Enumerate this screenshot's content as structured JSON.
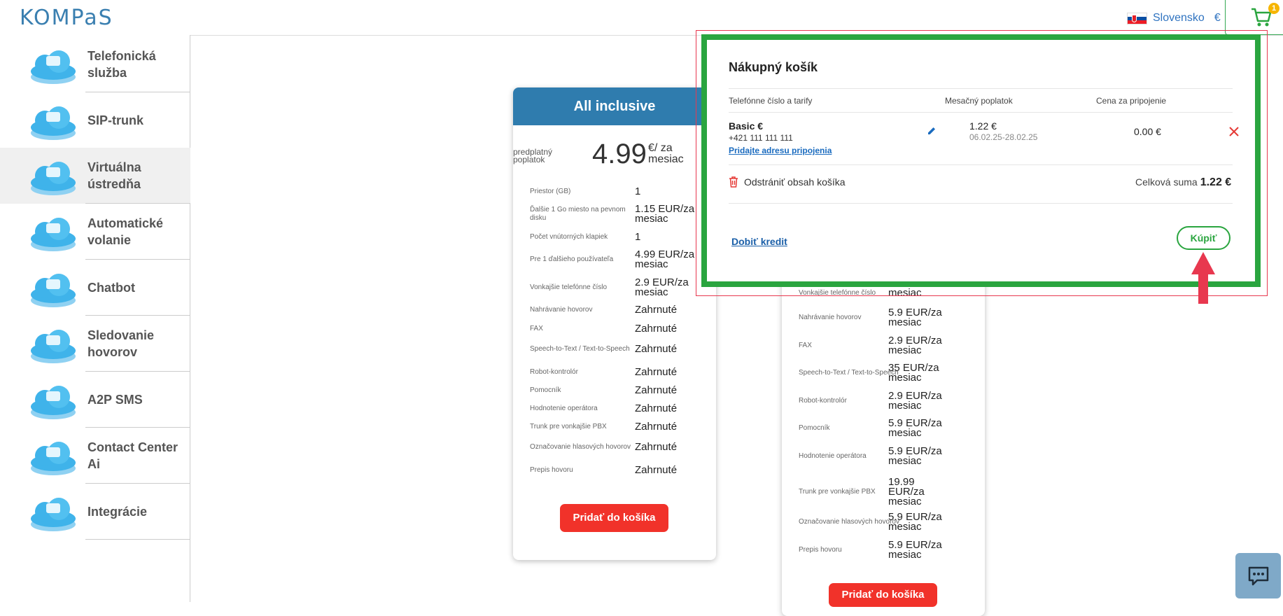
{
  "header": {
    "logo": "KOMPaS",
    "language": "Slovensko",
    "currency": "€",
    "cart_count": "1"
  },
  "sidebar": {
    "items": [
      {
        "label": "Telefonická služba",
        "icon": "phone-service-cloud-icon"
      },
      {
        "label": "SIP-trunk",
        "icon": "sip-trunk-cloud-icon"
      },
      {
        "label": "Virtuálna ústredňa",
        "icon": "virtual-pbx-cloud-icon"
      },
      {
        "label": "Automatické volanie",
        "icon": "auto-dialer-cloud-icon"
      },
      {
        "label": "Chatbot",
        "icon": "chatbot-cloud-icon"
      },
      {
        "label": "Sledovanie hovorov",
        "icon": "call-tracking-cloud-icon"
      },
      {
        "label": "A2P SMS",
        "icon": "sms-cloud-icon"
      },
      {
        "label": "Contact Center Ai",
        "icon": "contact-center-cloud-icon"
      },
      {
        "label": "Integrácie",
        "icon": "integrations-cloud-icon"
      }
    ]
  },
  "plan1": {
    "title": "All inclusive",
    "fee_label": "predplatný poplatok",
    "price": "4.99",
    "price_unit": "€/ za mesiac",
    "rows": [
      {
        "k": "Priestor (GB)",
        "v": "1"
      },
      {
        "k": "Ďalšie 1 Go miesto na pevnom disku",
        "v": "1.15 EUR/za mesiac"
      },
      {
        "k": "Počet vnútorných klapiek",
        "v": "1"
      },
      {
        "k": "Pre 1 ďalšieho používateľa",
        "v": "4.99 EUR/za mesiac"
      },
      {
        "k": "Vonkajšie telefónne číslo",
        "v": "2.9 EUR/za mesiac"
      },
      {
        "k": "Nahrávanie hovorov",
        "v": "Zahrnuté"
      },
      {
        "k": "FAX",
        "v": "Zahrnuté"
      },
      {
        "k": "Speech-to-Text / Text-to-Speech",
        "v": "Zahrnuté"
      },
      {
        "k": "Robot-kontrolór",
        "v": "Zahrnuté"
      },
      {
        "k": "Pomocník",
        "v": "Zahrnuté"
      },
      {
        "k": "Hodnotenie operátora",
        "v": "Zahrnuté"
      },
      {
        "k": "Trunk pre vonkajšie PBX",
        "v": "Zahrnuté"
      },
      {
        "k": "Označovanie hlasových hovorov",
        "v": "Zahrnuté"
      },
      {
        "k": "Prepis hovoru",
        "v": "Zahrnuté"
      }
    ],
    "button": "Pridať do košíka"
  },
  "plan2": {
    "partial_row": {
      "k": "Vonkajšie telefónne číslo",
      "v": "mesiac"
    },
    "rows": [
      {
        "k": "Nahrávanie hovorov",
        "v": "5.9 EUR/za mesiac"
      },
      {
        "k": "FAX",
        "v": "2.9 EUR/za mesiac"
      },
      {
        "k": "Speech-to-Text / Text-to-Speech",
        "v": "35 EUR/za mesiac"
      },
      {
        "k": "Robot-kontrolór",
        "v": "2.9 EUR/za mesiac"
      },
      {
        "k": "Pomocník",
        "v": "5.9 EUR/za mesiac"
      },
      {
        "k": "Hodnotenie operátora",
        "v": "5.9 EUR/za mesiac"
      },
      {
        "k": "Trunk pre vonkajšie PBX",
        "v": "19.99 EUR/za mesiac"
      },
      {
        "k": "Označovanie hlasových hovorov",
        "v": "5.9 EUR/za mesiac"
      },
      {
        "k": "Prepis hovoru",
        "v": "5.9 EUR/za mesiac"
      }
    ],
    "button": "Pridať do košíka"
  },
  "cart": {
    "title": "Nákupný košík",
    "col_number": "Telefónne číslo a tarify",
    "col_monthly": "Mesačný poplatok",
    "col_connection": "Cena za pripojenie",
    "item": {
      "name": "Basic €",
      "number": "+421 111 111 111",
      "add_address": "Pridajte adresu pripojenia",
      "monthly": "1.22 €",
      "period": "06.02.25-28.02.25",
      "connection": "0.00 €"
    },
    "clear_label": "Odstrániť obsah košíka",
    "total_label": "Celková suma",
    "total_value": "1.22 €",
    "topup": "Dobiť kredit",
    "buy": "Kúpiť"
  },
  "colors": {
    "accent_blue": "#2f7cae",
    "highlight_green": "#2aa53f",
    "button_red": "#f1322a",
    "annotation_red": "#e8384f"
  }
}
